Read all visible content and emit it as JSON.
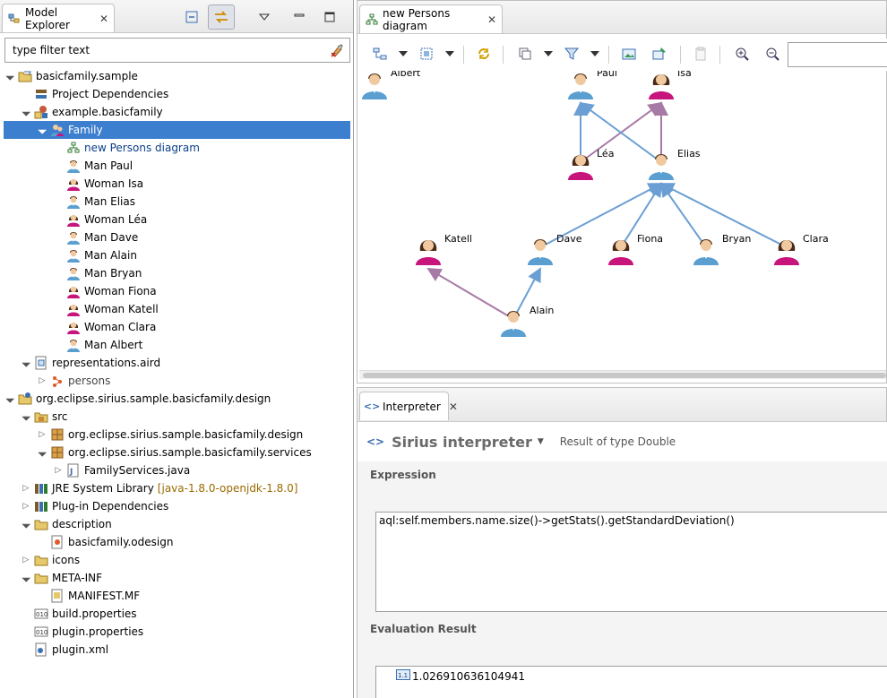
{
  "model_explorer": {
    "title": "Model Explorer",
    "filter_placeholder": "type filter text"
  },
  "tree": [
    {
      "label": "basicfamily.sample",
      "icon": "project-icon"
    },
    {
      "label": "Project Dependencies",
      "icon": "dependencies-icon"
    },
    {
      "label": "example.basicfamily",
      "icon": "model-icon"
    },
    {
      "label": "Family",
      "icon": "family-icon"
    },
    {
      "label": "new Persons diagram",
      "icon": "diagram-icon"
    },
    {
      "label": "Man Paul",
      "icon": "man-icon"
    },
    {
      "label": "Woman Isa",
      "icon": "woman-icon"
    },
    {
      "label": "Man Elias",
      "icon": "man-icon"
    },
    {
      "label": "Woman Léa",
      "icon": "woman-icon"
    },
    {
      "label": "Man Dave",
      "icon": "man-icon"
    },
    {
      "label": "Man Alain",
      "icon": "man-icon"
    },
    {
      "label": "Man Bryan",
      "icon": "man-icon"
    },
    {
      "label": "Woman Fiona",
      "icon": "woman-icon"
    },
    {
      "label": "Woman Katell",
      "icon": "woman-icon"
    },
    {
      "label": "Woman Clara",
      "icon": "woman-icon"
    },
    {
      "label": "Man Albert",
      "icon": "man-icon"
    },
    {
      "label": "representations.aird",
      "icon": "aird-icon"
    },
    {
      "label": "persons",
      "icon": "viewpoint-icon"
    },
    {
      "label": "org.eclipse.sirius.sample.basicfamily.design",
      "icon": "plugin-project-icon"
    },
    {
      "label": "src",
      "icon": "source-folder-icon"
    },
    {
      "label": "org.eclipse.sirius.sample.basicfamily.design",
      "icon": "package-icon"
    },
    {
      "label": "org.eclipse.sirius.sample.basicfamily.services",
      "icon": "package-icon"
    },
    {
      "label": "FamilyServices.java",
      "icon": "java-file-icon"
    },
    {
      "label": "JRE System Library",
      "icon": "library-icon",
      "extra": "[java-1.8.0-openjdk-1.8.0]"
    },
    {
      "label": "Plug-in Dependencies",
      "icon": "library-icon"
    },
    {
      "label": "description",
      "icon": "folder-icon"
    },
    {
      "label": "basicfamily.odesign",
      "icon": "odesign-icon"
    },
    {
      "label": "icons",
      "icon": "folder-icon"
    },
    {
      "label": "META-INF",
      "icon": "folder-icon"
    },
    {
      "label": "MANIFEST.MF",
      "icon": "manifest-icon"
    },
    {
      "label": "build.properties",
      "icon": "properties-icon"
    },
    {
      "label": "plugin.properties",
      "icon": "properties-icon"
    },
    {
      "label": "plugin.xml",
      "icon": "xml-file-icon"
    }
  ],
  "diagram": {
    "tab_title": "new Persons diagram",
    "nodes": [
      {
        "name": "Albert",
        "gender": "man"
      },
      {
        "name": "Paul",
        "gender": "man"
      },
      {
        "name": "Isa",
        "gender": "woman"
      },
      {
        "name": "Léa",
        "gender": "woman"
      },
      {
        "name": "Elias",
        "gender": "man"
      },
      {
        "name": "Katell",
        "gender": "woman"
      },
      {
        "name": "Dave",
        "gender": "man"
      },
      {
        "name": "Fiona",
        "gender": "woman"
      },
      {
        "name": "Bryan",
        "gender": "man"
      },
      {
        "name": "Clara",
        "gender": "woman"
      },
      {
        "name": "Alain",
        "gender": "man"
      }
    ],
    "edges": [
      {
        "from": "Léa",
        "to": "Paul",
        "kind": "father"
      },
      {
        "from": "Léa",
        "to": "Isa",
        "kind": "mother"
      },
      {
        "from": "Elias",
        "to": "Paul",
        "kind": "father"
      },
      {
        "from": "Elias",
        "to": "Isa",
        "kind": "mother"
      },
      {
        "from": "Dave",
        "to": "Elias",
        "kind": "father"
      },
      {
        "from": "Fiona",
        "to": "Elias",
        "kind": "father"
      },
      {
        "from": "Bryan",
        "to": "Elias",
        "kind": "father"
      },
      {
        "from": "Clara",
        "to": "Elias",
        "kind": "father"
      },
      {
        "from": "Alain",
        "to": "Dave",
        "kind": "father"
      },
      {
        "from": "Alain",
        "to": "Katell",
        "kind": "mother"
      }
    ]
  },
  "interpreter": {
    "tab_title": "Interpreter",
    "title": "Sirius interpreter",
    "result_type": "Result of type Double",
    "expression_label": "Expression",
    "expression": "aql:self.members.name.size()->getStats().getStandardDeviation()",
    "result_label": "Evaluation Result",
    "result_value": "1.026910636104941"
  },
  "colors": {
    "man": "#5b9fd0",
    "woman": "#c8157b",
    "father_edge": "#6b9fd4",
    "mother_edge": "#a77aa6",
    "selection": "#3d7fcf"
  }
}
